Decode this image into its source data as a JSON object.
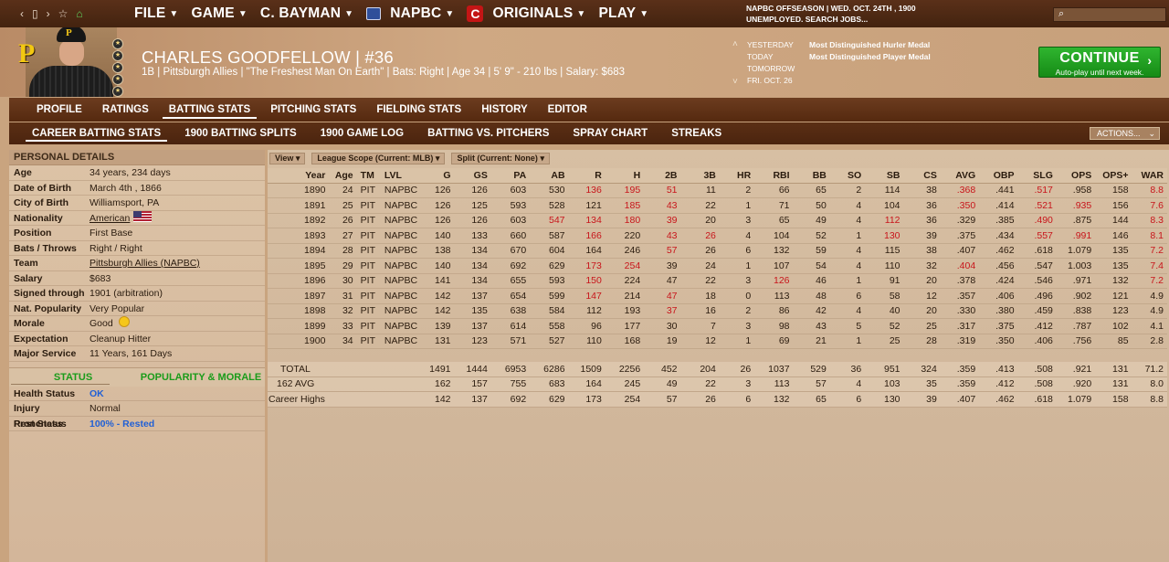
{
  "topbar": {
    "nav": {
      "back": "‹",
      "forward": "›",
      "star": "☆",
      "home": "⌂"
    },
    "menus": [
      {
        "label": "FILE"
      },
      {
        "label": "GAME"
      },
      {
        "label": "C. BAYMAN"
      },
      {
        "label": "NAPBC"
      },
      {
        "label": "ORIGINALS"
      },
      {
        "label": "PLAY"
      }
    ],
    "status_line1": "NAPBC OFFSEASON  |  WED. OCT. 24TH , 1900",
    "status_line2": "UNEMPLOYED. SEARCH JOBS...",
    "search_placeholder": ""
  },
  "player": {
    "logo_letter": "P",
    "name": "CHARLES GOODFELLOW  |  #36",
    "info": "1B | Pittsburgh Allies  |  \"The Freshest Man On Earth\" | Bats: Right  |  Age 34  |  5' 9\" - 210 lbs  |  Salary: $683"
  },
  "timeline": {
    "labels": [
      "YESTERDAY",
      "TODAY",
      "TOMORROW",
      "FRI. OCT. 26"
    ],
    "events": [
      "Most Distinguished Hurler Medal",
      "Most Distinguished Player Medal"
    ]
  },
  "continue": {
    "label": "CONTINUE",
    "sub": "Auto-play until next week."
  },
  "tabs_main": [
    "PROFILE",
    "RATINGS",
    "BATTING STATS",
    "PITCHING STATS",
    "FIELDING STATS",
    "HISTORY",
    "EDITOR"
  ],
  "tabs_sub": [
    "CAREER BATTING STATS",
    "1900 BATTING SPLITS",
    "1900 GAME LOG",
    "BATTING VS. PITCHERS",
    "SPRAY CHART",
    "STREAKS"
  ],
  "actions_label": "ACTIONS...",
  "personal": {
    "title": "PERSONAL DETAILS",
    "rows": [
      {
        "k": "Age",
        "v": "34 years, 234 days"
      },
      {
        "k": "Date of Birth",
        "v": "March 4th , 1866"
      },
      {
        "k": "City of Birth",
        "v": "Williamsport, PA"
      },
      {
        "k": "Nationality",
        "v": "American"
      },
      {
        "k": "Position",
        "v": "First Base"
      },
      {
        "k": "Bats / Throws",
        "v": "Right / Right"
      },
      {
        "k": "Team",
        "v": "Pittsburgh Allies (NAPBC)"
      },
      {
        "k": "Salary",
        "v": "$683"
      },
      {
        "k": "Signed through",
        "v": "1901 (arbitration)"
      },
      {
        "k": "Nat. Popularity",
        "v": "Very Popular"
      },
      {
        "k": "Morale",
        "v": "Good"
      },
      {
        "k": "Expectation",
        "v": "Cleanup Hitter"
      },
      {
        "k": "Major Service",
        "v": "11 Years, 161 Days"
      }
    ]
  },
  "status": {
    "tab_status": "STATUS",
    "tab_popularity": "POPULARITY & MORALE",
    "rows": [
      {
        "k": "Health Status",
        "v": "OK"
      },
      {
        "k": "Injury Proneness",
        "v": "Normal"
      },
      {
        "k": "Rest Status",
        "v": "100% - Rested"
      }
    ]
  },
  "stats": {
    "dropdowns": [
      "View",
      "League Scope (Current: MLB)",
      "Split  (Current: None)"
    ],
    "columns": [
      "Year",
      "Age",
      "TM",
      "LVL",
      "G",
      "GS",
      "PA",
      "AB",
      "R",
      "H",
      "2B",
      "3B",
      "HR",
      "RBI",
      "BB",
      "SO",
      "SB",
      "CS",
      "AVG",
      "OBP",
      "SLG",
      "OPS",
      "OPS+",
      "WAR"
    ],
    "rows": [
      [
        "1890",
        "24",
        "PIT",
        "NAPBC",
        "126",
        "126",
        "603",
        "530",
        "136",
        "195",
        "51",
        "11",
        "2",
        "66",
        "65",
        "2",
        "114",
        "38",
        ".368",
        ".441",
        ".517",
        ".958",
        "158",
        "8.8"
      ],
      [
        "1891",
        "25",
        "PIT",
        "NAPBC",
        "126",
        "125",
        "593",
        "528",
        "121",
        "185",
        "43",
        "22",
        "1",
        "71",
        "50",
        "4",
        "104",
        "36",
        ".350",
        ".414",
        ".521",
        ".935",
        "156",
        "7.6"
      ],
      [
        "1892",
        "26",
        "PIT",
        "NAPBC",
        "126",
        "126",
        "603",
        "547",
        "134",
        "180",
        "39",
        "20",
        "3",
        "65",
        "49",
        "4",
        "112",
        "36",
        ".329",
        ".385",
        ".490",
        ".875",
        "144",
        "8.3"
      ],
      [
        "1893",
        "27",
        "PIT",
        "NAPBC",
        "140",
        "133",
        "660",
        "587",
        "166",
        "220",
        "43",
        "26",
        "4",
        "104",
        "52",
        "1",
        "130",
        "39",
        ".375",
        ".434",
        ".557",
        ".991",
        "146",
        "8.1"
      ],
      [
        "1894",
        "28",
        "PIT",
        "NAPBC",
        "138",
        "134",
        "670",
        "604",
        "164",
        "246",
        "57",
        "26",
        "6",
        "132",
        "59",
        "4",
        "115",
        "38",
        ".407",
        ".462",
        ".618",
        "1.079",
        "135",
        "7.2"
      ],
      [
        "1895",
        "29",
        "PIT",
        "NAPBC",
        "140",
        "134",
        "692",
        "629",
        "173",
        "254",
        "39",
        "24",
        "1",
        "107",
        "54",
        "4",
        "110",
        "32",
        ".404",
        ".456",
        ".547",
        "1.003",
        "135",
        "7.4"
      ],
      [
        "1896",
        "30",
        "PIT",
        "NAPBC",
        "141",
        "134",
        "655",
        "593",
        "150",
        "224",
        "47",
        "22",
        "3",
        "126",
        "46",
        "1",
        "91",
        "20",
        ".378",
        ".424",
        ".546",
        ".971",
        "132",
        "7.2"
      ],
      [
        "1897",
        "31",
        "PIT",
        "NAPBC",
        "142",
        "137",
        "654",
        "599",
        "147",
        "214",
        "47",
        "18",
        "0",
        "113",
        "48",
        "6",
        "58",
        "12",
        ".357",
        ".406",
        ".496",
        ".902",
        "121",
        "4.9"
      ],
      [
        "1898",
        "32",
        "PIT",
        "NAPBC",
        "142",
        "135",
        "638",
        "584",
        "112",
        "193",
        "37",
        "16",
        "2",
        "86",
        "42",
        "4",
        "40",
        "20",
        ".330",
        ".380",
        ".459",
        ".838",
        "123",
        "4.9"
      ],
      [
        "1899",
        "33",
        "PIT",
        "NAPBC",
        "139",
        "137",
        "614",
        "558",
        "96",
        "177",
        "30",
        "7",
        "3",
        "98",
        "43",
        "5",
        "52",
        "25",
        ".317",
        ".375",
        ".412",
        ".787",
        "102",
        "4.1"
      ],
      [
        "1900",
        "34",
        "PIT",
        "NAPBC",
        "131",
        "123",
        "571",
        "527",
        "110",
        "168",
        "19",
        "12",
        "1",
        "69",
        "21",
        "1",
        "25",
        "28",
        ".319",
        ".350",
        ".406",
        ".756",
        "85",
        "2.8"
      ]
    ],
    "red_cells": [
      [
        0,
        8
      ],
      [
        0,
        9
      ],
      [
        0,
        10
      ],
      [
        0,
        18
      ],
      [
        0,
        20
      ],
      [
        0,
        23
      ],
      [
        1,
        9
      ],
      [
        1,
        10
      ],
      [
        1,
        18
      ],
      [
        1,
        20
      ],
      [
        1,
        21
      ],
      [
        1,
        23
      ],
      [
        2,
        7
      ],
      [
        2,
        8
      ],
      [
        2,
        9
      ],
      [
        2,
        10
      ],
      [
        2,
        16
      ],
      [
        2,
        20
      ],
      [
        2,
        23
      ],
      [
        3,
        8
      ],
      [
        3,
        10
      ],
      [
        3,
        11
      ],
      [
        3,
        16
      ],
      [
        3,
        20
      ],
      [
        3,
        21
      ],
      [
        3,
        23
      ],
      [
        4,
        10
      ],
      [
        4,
        23
      ],
      [
        5,
        8
      ],
      [
        5,
        9
      ],
      [
        5,
        18
      ],
      [
        5,
        23
      ],
      [
        6,
        8
      ],
      [
        6,
        13
      ],
      [
        6,
        23
      ],
      [
        7,
        8
      ],
      [
        7,
        10
      ],
      [
        8,
        10
      ]
    ],
    "totals": [
      [
        "TOTAL",
        "",
        "",
        "",
        "1491",
        "1444",
        "6953",
        "6286",
        "1509",
        "2256",
        "452",
        "204",
        "26",
        "1037",
        "529",
        "36",
        "951",
        "324",
        ".359",
        ".413",
        ".508",
        ".921",
        "131",
        "71.2"
      ],
      [
        "162 AVG",
        "",
        "",
        "",
        "162",
        "157",
        "755",
        "683",
        "164",
        "245",
        "49",
        "22",
        "3",
        "113",
        "57",
        "4",
        "103",
        "35",
        ".359",
        ".412",
        ".508",
        ".920",
        "131",
        "8.0"
      ],
      [
        "Career Highs",
        "",
        "",
        "",
        "142",
        "137",
        "692",
        "629",
        "173",
        "254",
        "57",
        "26",
        "6",
        "132",
        "65",
        "6",
        "130",
        "39",
        ".407",
        ".462",
        ".618",
        "1.079",
        "158",
        "8.8"
      ]
    ]
  }
}
